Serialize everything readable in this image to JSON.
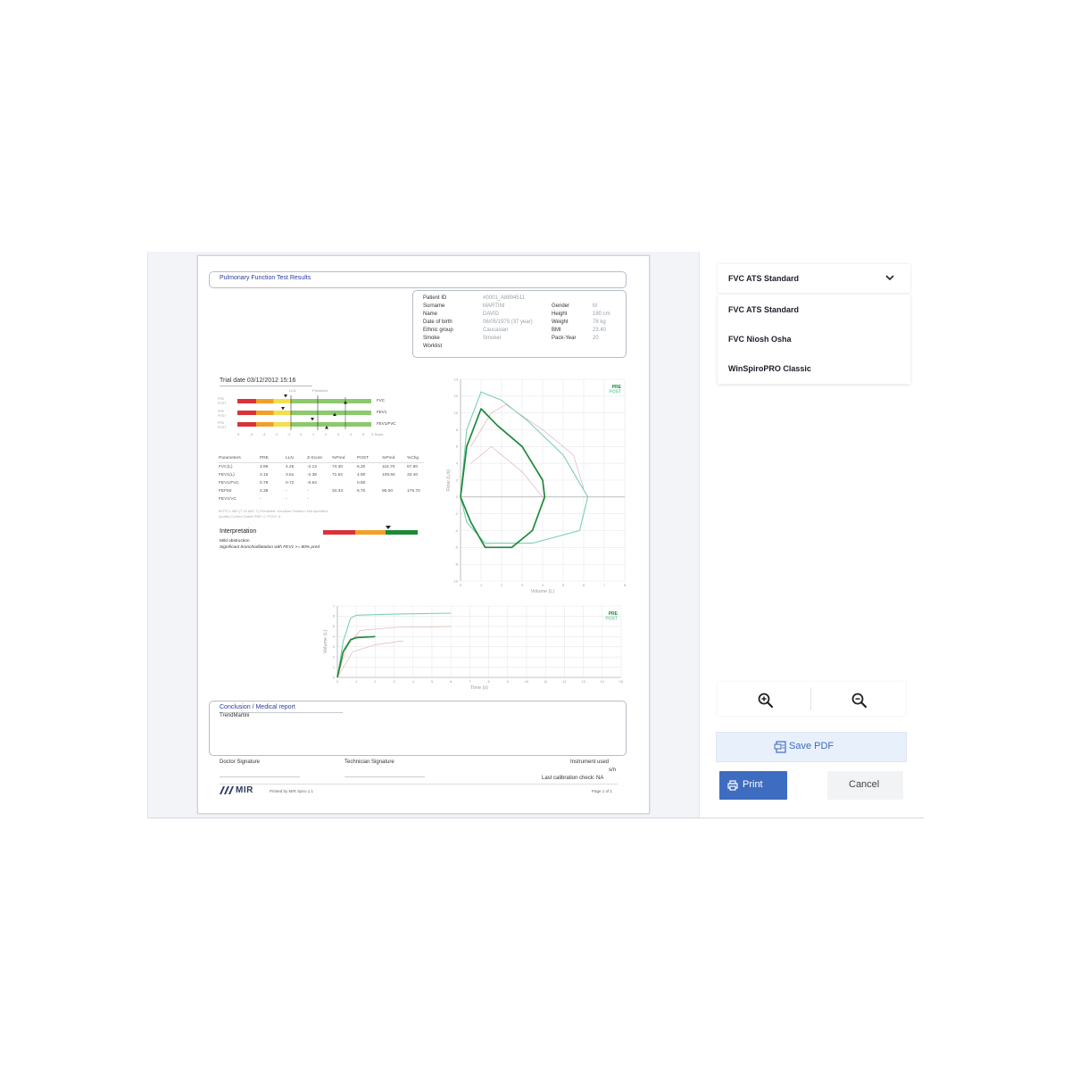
{
  "report": {
    "title": "Pulmonary Function Test Results",
    "patient": {
      "labels": [
        "Patient ID",
        "Surname",
        "Name",
        "Date of birth",
        "Ethnic group",
        "Smoke",
        "Worklist"
      ],
      "values": [
        "#0001_A8894511",
        "MARTINI",
        "DAVID",
        "06/05/1975 (37 year)",
        "Caucasian",
        "Smoker",
        ""
      ],
      "labels2": [
        "Gender",
        "Height",
        "Weight",
        "BMI",
        "Pack-Year"
      ],
      "values2": [
        "M",
        "180 cm",
        "78 kg",
        "23.40",
        "20"
      ]
    },
    "trial_date": "Trial date 03/12/2012 15:16",
    "bars": {
      "top_labels": [
        "LLN",
        "Predicted"
      ],
      "row_labels": [
        "FVC",
        "FEV1",
        "FEV1/FVC"
      ],
      "side_labels": [
        "PRE",
        "POST"
      ],
      "scale": [
        "5",
        "-4",
        "-3",
        "-2",
        "-1",
        "0",
        "1",
        "2",
        "3",
        "4",
        "5",
        "Z-Score"
      ]
    },
    "table": {
      "headers": [
        "Parameters",
        "PRE",
        "LLN",
        "Z-Score",
        "%Pred",
        "POST",
        "%Pred",
        "%Chg"
      ],
      "rows": [
        [
          "FVC(L)",
          "3.99",
          "4.26",
          "-2.13",
          "74.30",
          "6.20",
          "116.70",
          "57.80"
        ],
        [
          "FEV1(L)",
          "3.15",
          "3.51",
          "-2.38",
          "71.62",
          "4.90",
          "109.84",
          "33.40"
        ],
        [
          "FEV1/FVC",
          "0.79",
          "0.72",
          "-0.54",
          "",
          "0.80",
          "",
          ""
        ],
        [
          "FEF50",
          "2.38",
          "-",
          "-",
          "34.33",
          "5.70",
          "95.00",
          "176.70"
        ],
        [
          "FEV1/VC",
          "-",
          "-",
          "-",
          "",
          "",
          "",
          ""
        ]
      ],
      "note1": "BTPS 1.080 (T 21.88C T)  Predicted: Knudson  Position: Not specified",
      "note2": "Quality Control Grade          PRE: C       POST: A"
    },
    "interpretation": {
      "title": "Interpretation",
      "line1": "Mild obstruction",
      "line2": "Significant bronchodilatation with FEV1 >= 80% pred"
    },
    "conclusion": {
      "title": "Conclusion / Medical report",
      "text": "TrendMartini"
    },
    "doctor_signature": "Doctor Signature",
    "technician_signature": "Technician Signature",
    "instrument": "Instrument used",
    "instrument_sn": "s/n",
    "calibration": "Last calibration check: NA",
    "logo": "MIR",
    "printed_by": "Printed by MIR Spiro 1.1",
    "page_num": "Page 1 of 1"
  },
  "chart_data": [
    {
      "type": "line",
      "title": "",
      "xlabel": "Volume (L)",
      "ylabel": "Flow (L/s)",
      "xlim": [
        0,
        8
      ],
      "ylim": [
        -10,
        14
      ],
      "x_ticks": [
        0,
        1,
        2,
        3,
        4,
        5,
        6,
        7,
        8
      ],
      "y_ticks": [
        14,
        12,
        10,
        8,
        6,
        4,
        2,
        0,
        -2,
        -4,
        -6,
        -8,
        -10
      ],
      "legend": [
        "PRE",
        "POST"
      ],
      "legend_position": "top-right",
      "grid": true,
      "series": [
        {
          "name": "PRE",
          "color": "#1d8a38",
          "points": [
            [
              0,
              0
            ],
            [
              0.3,
              6
            ],
            [
              1,
              10.5
            ],
            [
              1.8,
              8.5
            ],
            [
              3,
              6
            ],
            [
              4,
              2
            ],
            [
              4.1,
              0
            ],
            [
              3.5,
              -4
            ],
            [
              2.5,
              -6
            ],
            [
              1.2,
              -6
            ],
            [
              0.5,
              -3
            ],
            [
              0,
              0
            ]
          ]
        },
        {
          "name": "POST",
          "color": "#7dcfb2",
          "points": [
            [
              0,
              0
            ],
            [
              0.3,
              8
            ],
            [
              1,
              12.5
            ],
            [
              2,
              11.5
            ],
            [
              3.3,
              9
            ],
            [
              5,
              5
            ],
            [
              6.2,
              0
            ],
            [
              5.8,
              -4
            ],
            [
              3.5,
              -5.5
            ],
            [
              1.2,
              -5.5
            ],
            [
              0.3,
              -3
            ],
            [
              0,
              0
            ]
          ]
        },
        {
          "name": "",
          "color": "#e0a6a6",
          "points": [
            [
              0.5,
              6
            ],
            [
              1.5,
              10
            ],
            [
              2.2,
              11
            ],
            [
              4,
              8
            ],
            [
              5.5,
              5
            ],
            [
              6,
              1
            ]
          ]
        },
        {
          "name": "",
          "color": "#e0a6a6",
          "points": [
            [
              0.5,
              4
            ],
            [
              1.5,
              6
            ],
            [
              3,
              3
            ],
            [
              4,
              0
            ]
          ]
        }
      ]
    },
    {
      "type": "line",
      "title": "",
      "xlabel": "Time (s)",
      "ylabel": "Volume (L)",
      "xlim": [
        0,
        15
      ],
      "ylim": [
        0,
        7
      ],
      "x_ticks": [
        0,
        1,
        2,
        3,
        4,
        5,
        6,
        7,
        8,
        9,
        10,
        11,
        12,
        13,
        14,
        15
      ],
      "y_ticks": [
        7,
        6,
        5,
        4,
        3,
        2,
        1,
        0
      ],
      "legend": [
        "PRE",
        "POST"
      ],
      "legend_position": "top-right",
      "grid": true,
      "series": [
        {
          "name": "PRE",
          "color": "#1d8a38",
          "points": [
            [
              0,
              0
            ],
            [
              0.3,
              2.5
            ],
            [
              0.7,
              3.7
            ],
            [
              1,
              3.9
            ],
            [
              2,
              4.0
            ]
          ]
        },
        {
          "name": "POST",
          "color": "#7dcfb2",
          "points": [
            [
              0,
              0
            ],
            [
              0.3,
              3.5
            ],
            [
              0.7,
              5.8
            ],
            [
              1,
              6.1
            ],
            [
              3,
              6.2
            ],
            [
              6,
              6.3
            ]
          ]
        },
        {
          "name": "",
          "color": "#e0a6a6",
          "points": [
            [
              0,
              0
            ],
            [
              0.5,
              3
            ],
            [
              1.2,
              4.6
            ],
            [
              3,
              4.9
            ],
            [
              6,
              5.0
            ]
          ]
        },
        {
          "name": "",
          "color": "#e0a6a6",
          "points": [
            [
              0,
              0
            ],
            [
              0.8,
              2.5
            ],
            [
              2,
              3.2
            ],
            [
              3.5,
              3.6
            ]
          ]
        }
      ]
    }
  ],
  "sidebar": {
    "selected": "FVC ATS Standard",
    "options": [
      "FVC ATS Standard",
      "FVC Niosh Osha",
      "WinSpiroPRO Classic"
    ],
    "save_pdf": "Save PDF",
    "print": "Print",
    "cancel": "Cancel"
  },
  "colors": {
    "accent": "#3e6cc0",
    "pre": "#1d8a38",
    "post": "#7dcfb2",
    "header_text": "#2b3aa0"
  }
}
